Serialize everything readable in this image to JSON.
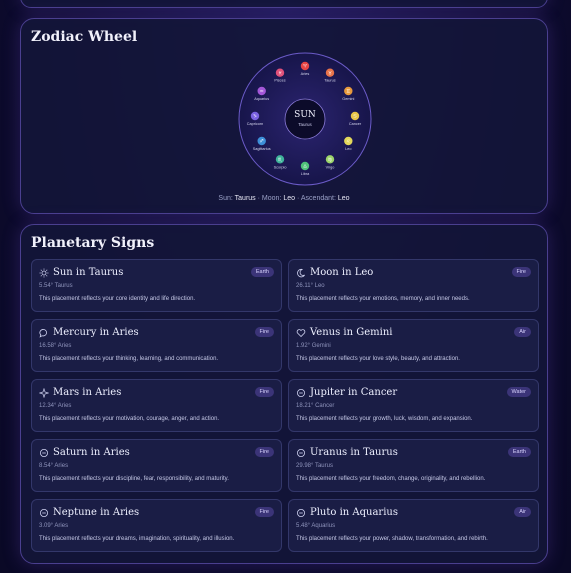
{
  "wheel": {
    "title": "Zodiac Wheel",
    "center_label": "SUN",
    "center_sub": "Taurus",
    "signs": [
      {
        "name": "Pisces",
        "glyph": "♓",
        "color": "#e0507a"
      },
      {
        "name": "Aries",
        "glyph": "♈",
        "color": "#e84545"
      },
      {
        "name": "Taurus",
        "glyph": "♉",
        "color": "#e8734a"
      },
      {
        "name": "Gemini",
        "glyph": "♊",
        "color": "#e89a3c"
      },
      {
        "name": "Cancer",
        "glyph": "♋",
        "color": "#e8c448"
      },
      {
        "name": "Leo",
        "glyph": "♌",
        "color": "#e3d85a"
      },
      {
        "name": "Virgo",
        "glyph": "♍",
        "color": "#9cd46a"
      },
      {
        "name": "Libra",
        "glyph": "♎",
        "color": "#4fc27a"
      },
      {
        "name": "Scorpio",
        "glyph": "♏",
        "color": "#3fb39a"
      },
      {
        "name": "Sagittarius",
        "glyph": "♐",
        "color": "#3d8fd8"
      },
      {
        "name": "Capricorn",
        "glyph": "♑",
        "color": "#7a62e0"
      },
      {
        "name": "Aquarius",
        "glyph": "♒",
        "color": "#a457d8"
      }
    ],
    "footer": {
      "sun_label": "Sun:",
      "sun_value": "Taurus",
      "moon_label": "Moon:",
      "moon_value": "Leo",
      "asc_label": "Ascendant:",
      "asc_value": "Leo",
      "sep": "·"
    }
  },
  "signs_panel": {
    "title": "Planetary Signs",
    "cards": [
      {
        "title": "Sun in Taurus",
        "badge": "Earth",
        "degree": "5.54° Taurus",
        "desc": "This placement reflects your core identity and life direction.",
        "icon": "sun-icon"
      },
      {
        "title": "Moon in Leo",
        "badge": "Fire",
        "degree": "26.11° Leo",
        "desc": "This placement reflects your emotions, memory, and inner needs.",
        "icon": "moon-icon"
      },
      {
        "title": "Mercury in Aries",
        "badge": "Fire",
        "degree": "16.58° Aries",
        "desc": "This placement reflects your thinking, learning, and communication.",
        "icon": "chat-icon"
      },
      {
        "title": "Venus in Gemini",
        "badge": "Air",
        "degree": "1.92° Gemini",
        "desc": "This placement reflects your love style, beauty, and attraction.",
        "icon": "heart-icon"
      },
      {
        "title": "Mars in Aries",
        "badge": "Fire",
        "degree": "12.34° Aries",
        "desc": "This placement reflects your motivation, courage, anger, and action.",
        "icon": "star-icon"
      },
      {
        "title": "Jupiter in Cancer",
        "badge": "Water",
        "degree": "18.21° Cancer",
        "desc": "This placement reflects your growth, luck, wisdom, and expansion.",
        "icon": "planet-icon"
      },
      {
        "title": "Saturn in Aries",
        "badge": "Fire",
        "degree": "8.54° Aries",
        "desc": "This placement reflects your discipline, fear, responsibility, and maturity.",
        "icon": "planet-icon"
      },
      {
        "title": "Uranus in Taurus",
        "badge": "Earth",
        "degree": "29.98° Taurus",
        "desc": "This placement reflects your freedom, change, originality, and rebellion.",
        "icon": "planet-icon"
      },
      {
        "title": "Neptune in Aries",
        "badge": "Fire",
        "degree": "3.09° Aries",
        "desc": "This placement reflects your dreams, imagination, spirituality, and illusion.",
        "icon": "planet-icon"
      },
      {
        "title": "Pluto in Aquarius",
        "badge": "Air",
        "degree": "5.48° Aquarius",
        "desc": "This placement reflects your power, shadow, transformation, and rebirth.",
        "icon": "planet-icon"
      }
    ]
  }
}
